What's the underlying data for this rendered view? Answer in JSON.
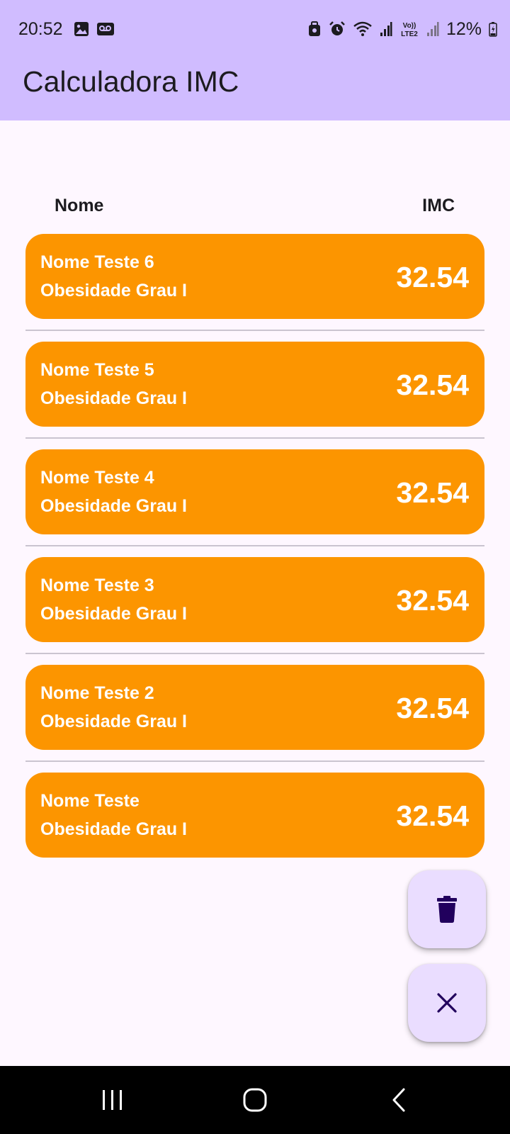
{
  "status_bar": {
    "time": "20:52",
    "battery": "12%",
    "left_icons": [
      "image-icon",
      "voicemail-icon"
    ],
    "right_icons": [
      "briefcase-icon",
      "alarm-icon",
      "wifi-icon",
      "signal-icon",
      "volte-icon",
      "signal-icon",
      "battery-icon"
    ],
    "volte_label": "Vo)) LTE2"
  },
  "app_bar": {
    "title": "Calculadora IMC"
  },
  "list": {
    "header_name": "Nome",
    "header_imc": "IMC",
    "items": [
      {
        "name": "Nome Teste 6",
        "category": "Obesidade Grau I",
        "imc": "32.54"
      },
      {
        "name": "Nome Teste 5",
        "category": "Obesidade Grau I",
        "imc": "32.54"
      },
      {
        "name": "Nome Teste 4",
        "category": "Obesidade Grau I",
        "imc": "32.54"
      },
      {
        "name": "Nome Teste 3",
        "category": "Obesidade Grau I",
        "imc": "32.54"
      },
      {
        "name": "Nome Teste 2",
        "category": "Obesidade Grau I",
        "imc": "32.54"
      },
      {
        "name": "Nome Teste",
        "category": "Obesidade Grau I",
        "imc": "32.54"
      }
    ]
  },
  "fabs": [
    {
      "icon": "trash-icon"
    },
    {
      "icon": "close-icon"
    }
  ],
  "nav_bar": {
    "icons": [
      "recents-icon",
      "home-icon",
      "back-icon"
    ]
  },
  "colors": {
    "app_bar": "#d0bcff",
    "background": "#fef7ff",
    "card": "#fc9500",
    "fab": "#eaddff",
    "fab_icon": "#21005d",
    "nav_bar": "#000000"
  }
}
